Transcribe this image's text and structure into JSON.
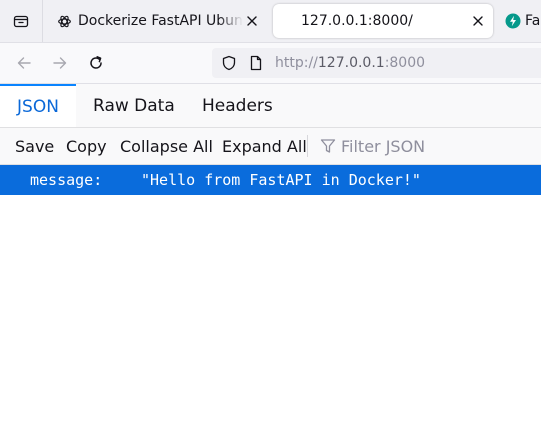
{
  "browser": {
    "tabs": [
      {
        "title": "Dockerize FastAPI Ubuntu",
        "favicon": "openai-icon",
        "active": false
      },
      {
        "title": "127.0.0.1:8000/",
        "active": true
      },
      {
        "title": "Fa",
        "favicon": "fastapi-icon",
        "active": false
      }
    ],
    "url": {
      "prefix": "http://",
      "host": "127.0.0.1",
      "suffix": ":8000"
    }
  },
  "viewer": {
    "tabs": [
      "JSON",
      "Raw Data",
      "Headers"
    ],
    "toolbar": {
      "save": "Save",
      "copy": "Copy",
      "collapse_all": "Collapse All",
      "expand_all": "Expand All",
      "filter_placeholder": "Filter JSON"
    },
    "rows": [
      {
        "key": "message:",
        "value": "\"Hello from FastAPI in Docker!\""
      }
    ]
  },
  "colors": {
    "accent": "#0a84ff",
    "selected_row": "#0a6cdc",
    "fastapi": "#05998b"
  }
}
